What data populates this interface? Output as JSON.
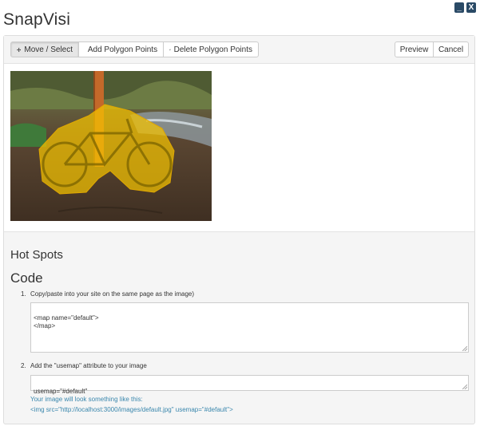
{
  "app": {
    "title": "SnapVisi"
  },
  "window": {
    "minimize": "_",
    "close": "X"
  },
  "toolbar": {
    "move_select": "Move / Select",
    "add_points": "Add Polygon Points",
    "delete_points": "Delete Polygon Points",
    "preview": "Preview",
    "cancel": "Cancel"
  },
  "sections": {
    "hot_spots": "Hot Spots",
    "code": "Code"
  },
  "steps": [
    {
      "num": "1.",
      "label": "Copy/paste into your site on the same page as the image)",
      "code": "<map name=\"default\">\n</map>"
    },
    {
      "num": "2.",
      "label": "Add the \"usemap\" attribute to your image",
      "code": "usemap=\"#default\""
    }
  ],
  "hint": {
    "line1": "Your image will look something like this:",
    "line2": "<img src=\"http://localhost:3000/images/default.jpg\" usemap=\"#default\">"
  },
  "colors": {
    "hotspot": "#f5c400",
    "accent": "#3a87ad"
  }
}
